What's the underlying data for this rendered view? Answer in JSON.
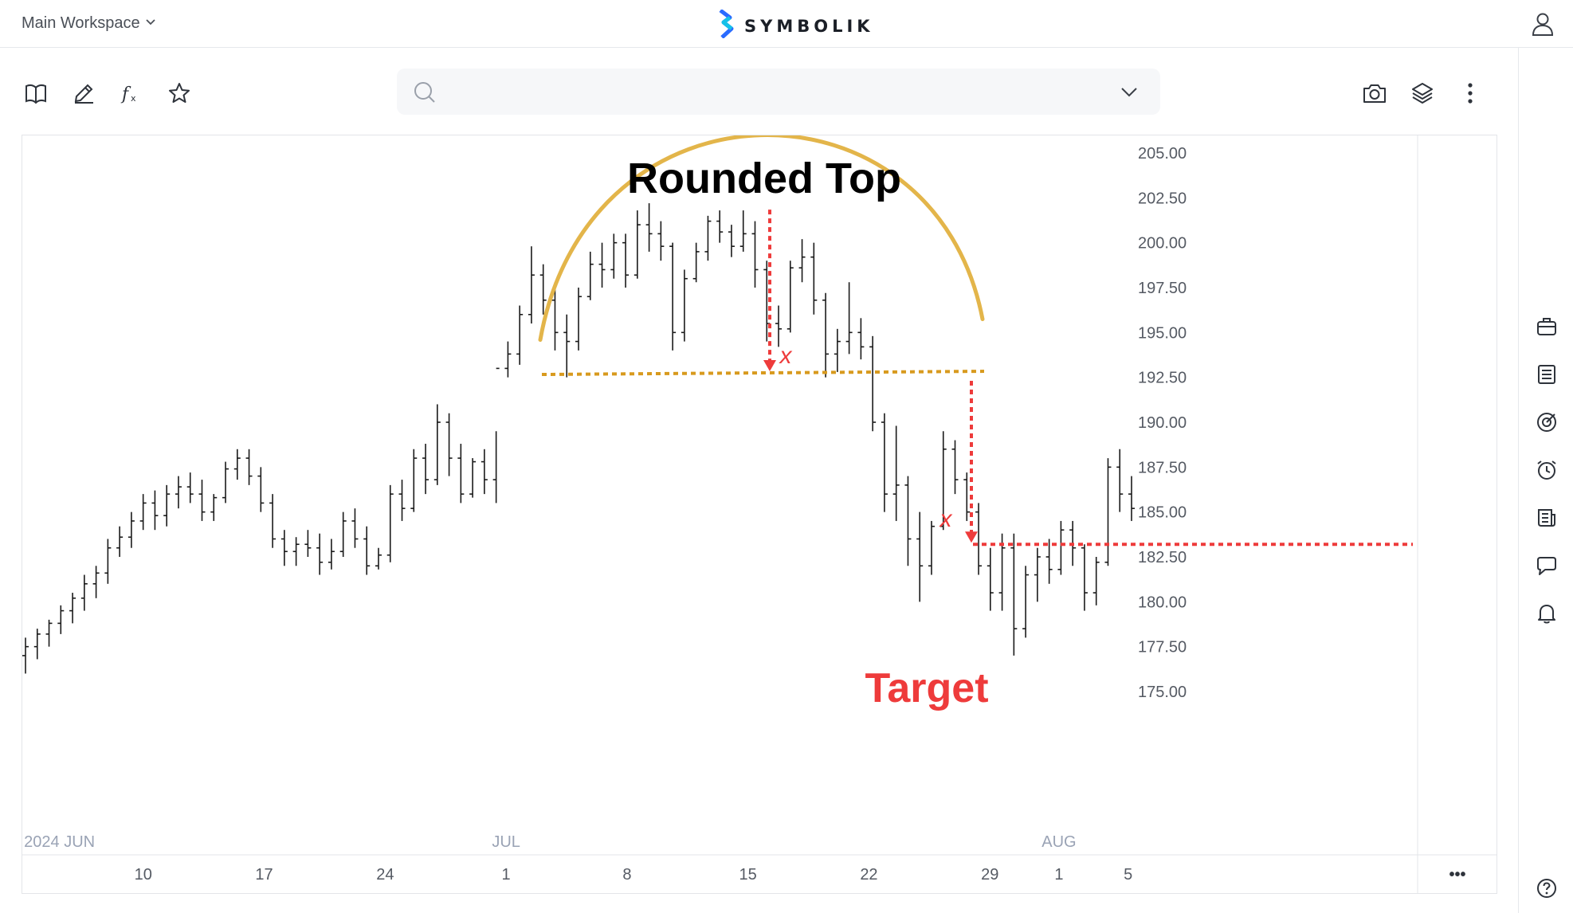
{
  "header": {
    "workspace_label": "Main Workspace",
    "brand_name": "SYMBOLIK"
  },
  "toolbar": {
    "search_placeholder": "",
    "tools": [
      "book-icon",
      "pencil-icon",
      "function-icon",
      "star-icon"
    ],
    "right_tools": [
      "camera-icon",
      "layers-icon",
      "more-vertical-icon"
    ]
  },
  "sidebar": {
    "items": [
      "briefcase-icon",
      "list-icon",
      "target-icon",
      "alarm-icon",
      "news-icon",
      "chat-icon",
      "bell-icon",
      "help-icon"
    ]
  },
  "colors": {
    "arc": "#e3b54a",
    "neckline": "#d89a1e",
    "target": "#ee3b3b",
    "bars": "#1a1a1a"
  },
  "chart_data": {
    "type": "ohlc",
    "title": "Rounded Top",
    "ylim": [
      175,
      206
    ],
    "y_ticks": [
      "205.00",
      "202.50",
      "200.00",
      "197.50",
      "195.00",
      "192.50",
      "190.00",
      "187.50",
      "185.00",
      "182.50",
      "180.00",
      "177.50",
      "175.00"
    ],
    "x_ticks": [
      {
        "label": "10",
        "day": 10
      },
      {
        "label": "17",
        "day": 17
      },
      {
        "label": "24",
        "day": 24
      },
      {
        "label": "1",
        "day": 31
      },
      {
        "label": "8",
        "day": 38
      },
      {
        "label": "15",
        "day": 45
      },
      {
        "label": "22",
        "day": 52
      },
      {
        "label": "29",
        "day": 59
      },
      {
        "label": "1",
        "day": 63
      },
      {
        "label": "5",
        "day": 67
      }
    ],
    "month_labels": [
      {
        "label": "2024 JUN",
        "day": 3.1
      },
      {
        "label": "JUL",
        "day": 31
      },
      {
        "label": "AUG",
        "day": 63
      }
    ],
    "x_range": [
      3,
      66
    ],
    "neckline_value": 192.75,
    "target_value": 183.2,
    "annotations": {
      "pattern": "Rounded Top",
      "target": "Target",
      "distance": "x"
    },
    "more_label": "•••",
    "bars": [
      [
        177.0,
        178.0,
        176.0,
        177.5
      ],
      [
        177.5,
        178.5,
        176.8,
        178.2
      ],
      [
        178.2,
        179.0,
        177.5,
        178.8
      ],
      [
        178.8,
        179.8,
        178.2,
        179.5
      ],
      [
        179.5,
        180.5,
        178.8,
        180.2
      ],
      [
        180.2,
        181.5,
        179.5,
        181.0
      ],
      [
        181.0,
        182.0,
        180.2,
        181.6
      ],
      [
        181.6,
        183.5,
        181.0,
        183.0
      ],
      [
        183.0,
        184.2,
        182.5,
        183.6
      ],
      [
        183.6,
        185.0,
        183.0,
        184.5
      ],
      [
        184.5,
        186.0,
        184.0,
        185.5
      ],
      [
        185.5,
        186.2,
        184.0,
        184.8
      ],
      [
        184.8,
        186.5,
        184.2,
        186.0
      ],
      [
        186.0,
        187.0,
        185.2,
        186.4
      ],
      [
        186.4,
        187.2,
        185.5,
        186.0
      ],
      [
        186.0,
        186.8,
        184.5,
        185.0
      ],
      [
        185.0,
        186.0,
        184.5,
        185.8
      ],
      [
        185.8,
        187.8,
        185.5,
        187.4
      ],
      [
        187.4,
        188.5,
        186.8,
        188.0
      ],
      [
        188.0,
        188.5,
        186.5,
        187.0
      ],
      [
        187.0,
        187.5,
        185.0,
        185.5
      ],
      [
        185.5,
        186.0,
        183.0,
        183.5
      ],
      [
        183.5,
        184.0,
        182.0,
        182.8
      ],
      [
        182.8,
        183.6,
        182.0,
        183.2
      ],
      [
        183.2,
        184.0,
        182.5,
        183.0
      ],
      [
        183.0,
        183.8,
        181.5,
        182.2
      ],
      [
        182.2,
        183.5,
        181.8,
        182.8
      ],
      [
        182.8,
        185.0,
        182.5,
        184.5
      ],
      [
        184.5,
        185.2,
        183.0,
        183.5
      ],
      [
        183.5,
        184.2,
        181.5,
        182.0
      ],
      [
        182.0,
        183.0,
        181.8,
        182.6
      ],
      [
        182.6,
        186.5,
        182.2,
        186.0
      ],
      [
        186.0,
        186.8,
        184.5,
        185.2
      ],
      [
        185.2,
        188.5,
        185.0,
        188.0
      ],
      [
        188.0,
        188.8,
        186.0,
        186.8
      ],
      [
        186.8,
        191.0,
        186.5,
        190.0
      ],
      [
        190.0,
        190.5,
        187.0,
        188.0
      ],
      [
        188.0,
        188.8,
        185.5,
        186.0
      ],
      [
        186.0,
        188.0,
        185.8,
        187.8
      ],
      [
        187.8,
        188.5,
        186.0,
        186.8
      ],
      [
        186.8,
        189.5,
        185.5,
        193.0
      ],
      [
        193.0,
        194.5,
        192.5,
        193.8
      ],
      [
        193.8,
        196.5,
        193.2,
        196.0
      ],
      [
        196.0,
        199.8,
        195.5,
        198.2
      ],
      [
        198.2,
        198.8,
        196.0,
        196.8
      ],
      [
        196.8,
        197.8,
        194.0,
        195.0
      ],
      [
        195.0,
        196.0,
        192.5,
        194.5
      ],
      [
        194.5,
        197.5,
        194.0,
        197.0
      ],
      [
        197.0,
        199.5,
        196.8,
        198.8
      ],
      [
        198.8,
        200.0,
        197.5,
        198.5
      ],
      [
        198.5,
        200.5,
        198.0,
        200.0
      ],
      [
        200.0,
        200.5,
        197.5,
        198.2
      ],
      [
        198.2,
        201.8,
        198.0,
        201.0
      ],
      [
        201.0,
        202.2,
        199.5,
        200.5
      ],
      [
        200.5,
        201.2,
        199.0,
        199.8
      ],
      [
        199.8,
        200.0,
        194.0,
        195.0
      ],
      [
        195.0,
        198.5,
        194.5,
        198.0
      ],
      [
        198.0,
        200.0,
        197.8,
        199.5
      ],
      [
        199.5,
        201.5,
        199.0,
        201.2
      ],
      [
        201.2,
        201.8,
        200.0,
        200.6
      ],
      [
        200.6,
        201.0,
        199.2,
        199.8
      ],
      [
        199.8,
        201.8,
        199.5,
        200.5
      ],
      [
        200.5,
        201.2,
        197.5,
        198.5
      ],
      [
        198.5,
        199.0,
        194.5,
        195.5
      ],
      [
        195.5,
        196.5,
        194.2,
        195.2
      ],
      [
        195.2,
        199.0,
        195.0,
        198.6
      ],
      [
        198.6,
        200.2,
        197.8,
        199.2
      ],
      [
        199.2,
        200.0,
        196.0,
        196.8
      ],
      [
        196.8,
        197.2,
        192.5,
        193.8
      ],
      [
        193.8,
        195.2,
        192.8,
        194.5
      ],
      [
        194.5,
        197.8,
        193.8,
        195.0
      ],
      [
        195.0,
        195.8,
        193.5,
        194.2
      ],
      [
        194.2,
        194.8,
        189.5,
        190.0
      ],
      [
        190.0,
        190.5,
        185.0,
        186.0
      ],
      [
        186.0,
        189.8,
        184.5,
        186.5
      ],
      [
        186.5,
        187.0,
        182.0,
        183.5
      ],
      [
        183.5,
        185.0,
        180.0,
        182.0
      ],
      [
        182.0,
        184.5,
        181.5,
        184.2
      ],
      [
        184.2,
        189.5,
        184.0,
        188.5
      ],
      [
        188.5,
        189.0,
        186.0,
        186.8
      ],
      [
        186.8,
        187.2,
        184.5,
        185.0
      ],
      [
        185.0,
        185.5,
        181.5,
        182.0
      ],
      [
        182.0,
        183.0,
        179.5,
        180.5
      ],
      [
        180.5,
        183.8,
        179.5,
        183.0
      ],
      [
        183.0,
        183.8,
        177.0,
        178.5
      ],
      [
        178.5,
        182.0,
        178.0,
        181.5
      ],
      [
        181.5,
        183.0,
        180.0,
        182.5
      ],
      [
        182.5,
        183.5,
        181.0,
        181.8
      ],
      [
        181.8,
        184.5,
        181.5,
        184.0
      ],
      [
        184.0,
        184.5,
        182.0,
        183.0
      ],
      [
        183.0,
        183.2,
        179.5,
        180.5
      ],
      [
        180.5,
        182.5,
        179.8,
        182.2
      ],
      [
        182.2,
        188.0,
        182.0,
        187.5
      ],
      [
        187.5,
        188.5,
        185.0,
        186.0
      ],
      [
        186.0,
        187.0,
        184.5,
        185.2
      ]
    ]
  }
}
